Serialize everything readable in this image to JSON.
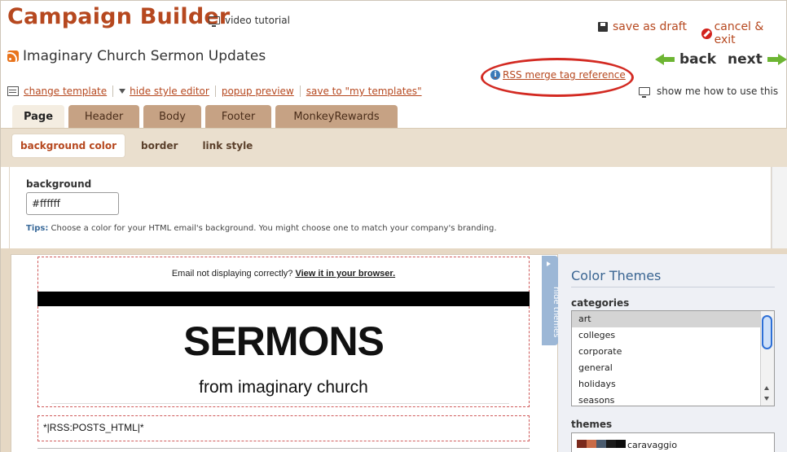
{
  "header": {
    "title": "Campaign Builder",
    "video_tutorial": "video tutorial",
    "save_as_draft": "save as draft",
    "cancel_exit": "cancel & exit"
  },
  "campaign": {
    "name": "Imaginary Church Sermon Updates",
    "rss_reference": "RSS merge tag reference"
  },
  "nav": {
    "back": "back",
    "next": "next"
  },
  "toolbar": {
    "change_template": "change template",
    "hide_style_editor": "hide style editor",
    "popup_preview": "popup preview",
    "save_to_templates": "save to \"my templates\"",
    "show_me": "show me how to use this"
  },
  "tabs": [
    {
      "label": "Page",
      "active": true
    },
    {
      "label": "Header",
      "active": false
    },
    {
      "label": "Body",
      "active": false
    },
    {
      "label": "Footer",
      "active": false
    },
    {
      "label": "MonkeyRewards",
      "active": false
    }
  ],
  "subtabs": [
    {
      "label": "background color",
      "active": true
    },
    {
      "label": "border",
      "active": false
    },
    {
      "label": "link style",
      "active": false
    }
  ],
  "editor": {
    "background_label": "background",
    "background_value": "#ffffff",
    "tips_label": "Tips:",
    "tips_text": " Choose a color for your HTML email's background. You might choose one to match your company's branding."
  },
  "preview": {
    "email_notice": "Email not displaying correctly? ",
    "view_browser": "View it in your browser.",
    "heading": "SERMONS",
    "subheading": "from imaginary church",
    "rss_tag": "*|RSS:POSTS_HTML|*"
  },
  "hide_themes": "hide themes",
  "themes": {
    "title": "Color Themes",
    "categories_label": "categories",
    "categories": [
      "art",
      "colleges",
      "corporate",
      "general",
      "holidays",
      "seasons"
    ],
    "selected_category": "art",
    "themes_label": "themes",
    "theme_name": "caravaggio",
    "theme_swatches": [
      "#7a2a1c",
      "#c86b47",
      "#4a5b6e",
      "#1b1b1b",
      "#0d0d0d"
    ]
  },
  "colors": {
    "accent": "#b6481f",
    "tab": "#c6a284",
    "highlight": "#d32a22",
    "nav_arrow": "#6db533"
  }
}
